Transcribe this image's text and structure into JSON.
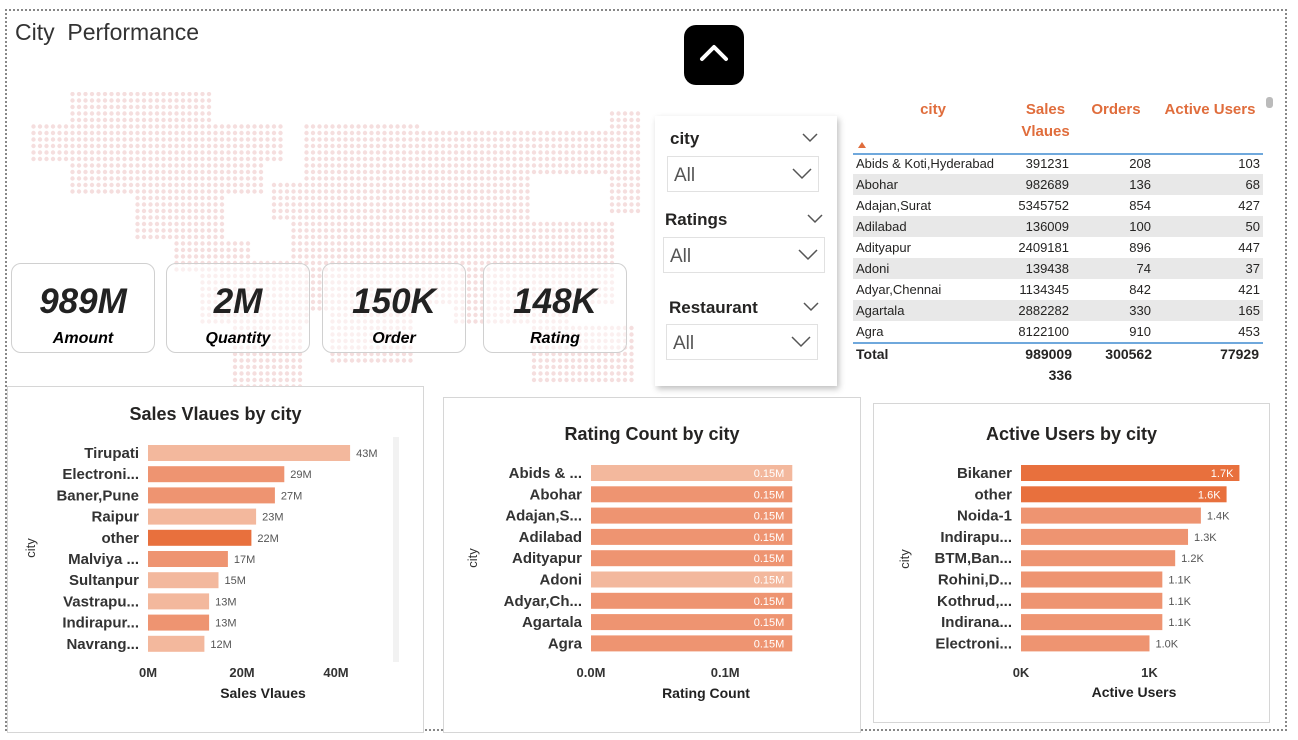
{
  "page": {
    "title": "City  Performance"
  },
  "kpis": [
    {
      "value": "989M",
      "label": "Amount"
    },
    {
      "value": "2M",
      "label": "Quantity"
    },
    {
      "value": "150K",
      "label": "Order"
    },
    {
      "value": "148K",
      "label": "Rating"
    }
  ],
  "slicers": [
    {
      "title": "city",
      "value": "All"
    },
    {
      "title": "Ratings",
      "value": "All"
    },
    {
      "title": "Restaurant",
      "value": "All"
    }
  ],
  "table": {
    "headers": [
      "city",
      "Sales Vlaues",
      "Orders",
      "Active Users"
    ],
    "rows": [
      [
        "Abids & Koti,Hyderabad",
        "391231",
        "208",
        "103"
      ],
      [
        "Abohar",
        "982689",
        "136",
        "68"
      ],
      [
        "Adajan,Surat",
        "5345752",
        "854",
        "427"
      ],
      [
        "Adilabad",
        "136009",
        "100",
        "50"
      ],
      [
        "Adityapur",
        "2409181",
        "896",
        "447"
      ],
      [
        "Adoni",
        "139438",
        "74",
        "37"
      ],
      [
        "Adyar,Chennai",
        "1134345",
        "842",
        "421"
      ],
      [
        "Agartala",
        "2882282",
        "330",
        "165"
      ],
      [
        "Agra",
        "8122100",
        "910",
        "453"
      ]
    ],
    "total": {
      "label": "Total",
      "sales": "989009",
      "sales_wrap": "336",
      "orders": "300562",
      "users": "77929"
    }
  },
  "colors": {
    "accent": "#e06d3c",
    "bar_dark": "#e8703d",
    "bar_mid": "#ee9471",
    "bar_light": "#f3b89d",
    "map_dots": "#f5dede"
  },
  "chart_data": [
    {
      "type": "bar",
      "orientation": "horizontal",
      "title": "Sales Vlaues by city",
      "xlabel": "Sales Vlaues",
      "ylabel": "city",
      "categories": [
        "Tirupati",
        "Electroni...",
        "Baner,Pune",
        "Raipur",
        "other",
        "Malviya ...",
        "Sultanpur",
        "Vastrapu...",
        "Indirapur...",
        "Navrang..."
      ],
      "values": [
        43,
        29,
        27,
        23,
        22,
        17,
        15,
        13,
        13,
        12
      ],
      "data_labels": [
        "43M",
        "29M",
        "27M",
        "23M",
        "22M",
        "17M",
        "15M",
        "13M",
        "13M",
        "12M"
      ],
      "bar_colors": [
        "#f3b89d",
        "#ee9471",
        "#ee9471",
        "#f3b89d",
        "#e8703d",
        "#ee9471",
        "#f3b89d",
        "#f3b89d",
        "#ee9471",
        "#f3b89d"
      ],
      "xticks": [
        0,
        20,
        40
      ],
      "xtick_labels": [
        "0M",
        "20M",
        "40M"
      ],
      "xlim": [
        0,
        50
      ]
    },
    {
      "type": "bar",
      "orientation": "horizontal",
      "title": "Rating Count by city",
      "xlabel": "Rating Count",
      "ylabel": "city",
      "categories": [
        "Abids & ...",
        "Abohar",
        "Adajan,S...",
        "Adilabad",
        "Adityapur",
        "Adoni",
        "Adyar,Ch...",
        "Agartala",
        "Agra"
      ],
      "values": [
        0.15,
        0.15,
        0.15,
        0.15,
        0.15,
        0.15,
        0.15,
        0.15,
        0.15
      ],
      "data_labels": [
        "0.15M",
        "0.15M",
        "0.15M",
        "0.15M",
        "0.15M",
        "0.15M",
        "0.15M",
        "0.15M",
        "0.15M"
      ],
      "bar_colors": [
        "#f3b89d",
        "#ee9471",
        "#ee9471",
        "#ee9471",
        "#ee9471",
        "#f3b89d",
        "#ee9471",
        "#ee9471",
        "#ee9471"
      ],
      "xticks": [
        0,
        0.1
      ],
      "xtick_labels": [
        "0.0M",
        "0.1M"
      ],
      "xlim": [
        0,
        0.155
      ]
    },
    {
      "type": "bar",
      "orientation": "horizontal",
      "title": "Active Users by city",
      "xlabel": "Active Users",
      "ylabel": "city",
      "categories": [
        "Bikaner",
        "other",
        "Noida-1",
        "Indirapu...",
        "BTM,Ban...",
        "Rohini,D...",
        "Kothrud,...",
        "Indirana...",
        "Electroni..."
      ],
      "values": [
        1.7,
        1.6,
        1.4,
        1.3,
        1.2,
        1.1,
        1.1,
        1.1,
        1.0
      ],
      "data_labels": [
        "1.7K",
        "1.6K",
        "1.4K",
        "1.3K",
        "1.2K",
        "1.1K",
        "1.1K",
        "1.1K",
        "1.0K"
      ],
      "bar_colors": [
        "#e8703d",
        "#e8703d",
        "#ee9471",
        "#ee9471",
        "#ee9471",
        "#ee9471",
        "#ee9471",
        "#ee9471",
        "#ee9471"
      ],
      "xticks": [
        0,
        1
      ],
      "xtick_labels": [
        "0K",
        "1K"
      ],
      "xlim": [
        0,
        1.65
      ]
    }
  ]
}
